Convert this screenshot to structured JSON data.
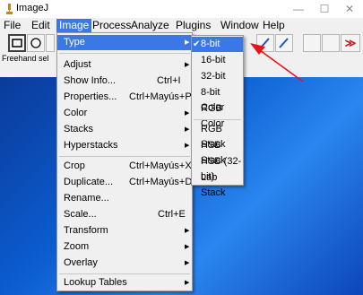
{
  "window": {
    "title": "ImageJ",
    "minimize_glyph": "—",
    "maximize_glyph": "☐",
    "close_glyph": "✕"
  },
  "menubar": {
    "items": [
      "File",
      "Edit",
      "Image",
      "Process",
      "Analyze",
      "Plugins",
      "Window",
      "Help"
    ]
  },
  "toolbar": {
    "more_glyph": "≫"
  },
  "status": {
    "text": "Freehand sel"
  },
  "image_menu": {
    "items": [
      {
        "label": "Type",
        "shortcut": "",
        "submenu": true
      },
      {
        "label": "Adjust",
        "shortcut": "",
        "submenu": true
      },
      {
        "label": "Show Info...",
        "shortcut": "Ctrl+I",
        "submenu": false
      },
      {
        "label": "Properties...",
        "shortcut": "Ctrl+Mayús+P",
        "submenu": false
      },
      {
        "label": "Color",
        "shortcut": "",
        "submenu": true
      },
      {
        "label": "Stacks",
        "shortcut": "",
        "submenu": true
      },
      {
        "label": "Hyperstacks",
        "shortcut": "",
        "submenu": true
      },
      {
        "label": "Crop",
        "shortcut": "Ctrl+Mayús+X",
        "submenu": false
      },
      {
        "label": "Duplicate...",
        "shortcut": "Ctrl+Mayús+D",
        "submenu": false
      },
      {
        "label": "Rename...",
        "shortcut": "",
        "submenu": false
      },
      {
        "label": "Scale...",
        "shortcut": "Ctrl+E",
        "submenu": false
      },
      {
        "label": "Transform",
        "shortcut": "",
        "submenu": true
      },
      {
        "label": "Zoom",
        "shortcut": "",
        "submenu": true
      },
      {
        "label": "Overlay",
        "shortcut": "",
        "submenu": true
      },
      {
        "label": "Lookup Tables",
        "shortcut": "",
        "submenu": true
      }
    ]
  },
  "type_submenu": {
    "items": [
      {
        "label": "8-bit",
        "checked": true
      },
      {
        "label": "16-bit",
        "checked": false
      },
      {
        "label": "32-bit",
        "checked": false
      },
      {
        "label": "8-bit Color",
        "checked": false
      },
      {
        "label": "RGB Color",
        "checked": false
      },
      {
        "label": "RGB Stack",
        "checked": false
      },
      {
        "label": "HSB Stack",
        "checked": false
      },
      {
        "label": "HSB (32-bit)",
        "checked": false
      },
      {
        "label": "Lab Stack",
        "checked": false
      }
    ]
  },
  "colors": {
    "highlight": "#3a78e8",
    "annotation_arrow": "#e8141b",
    "desktop": "#0b5ccf"
  }
}
